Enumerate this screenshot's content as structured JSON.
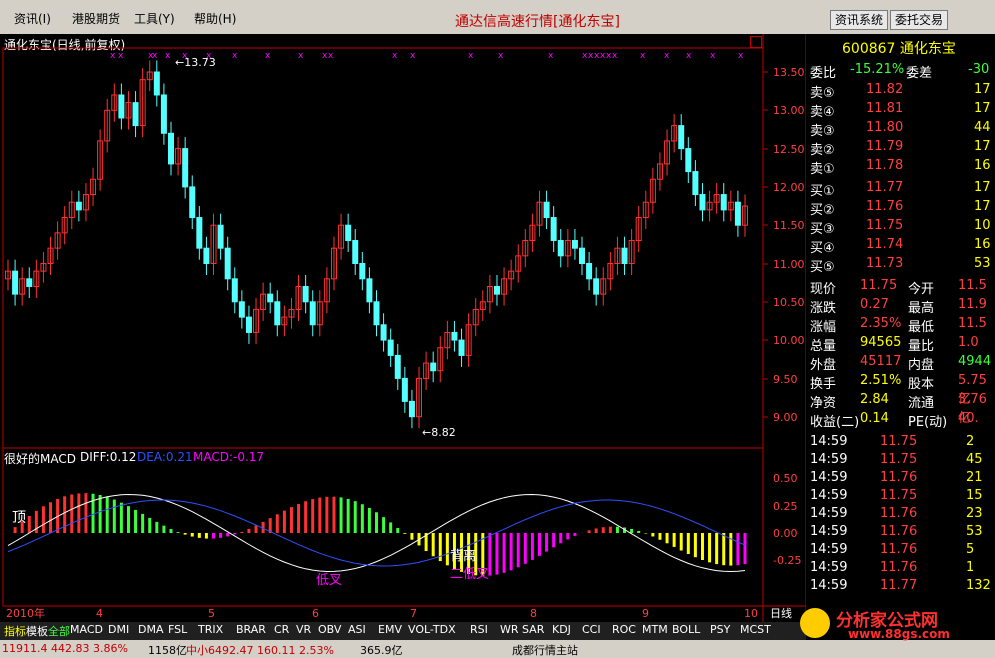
{
  "menu": {
    "items": [
      "资讯(I)",
      "港股期货",
      "工具(Y)",
      "帮助(H)"
    ]
  },
  "app_title": "通达信高速行情[通化东宝]",
  "buttons": {
    "news": "资讯系统",
    "trade": "委托交易"
  },
  "chart": {
    "title": "通化东宝(日线,前复权)",
    "price_ticks": [
      "13.50",
      "13.00",
      "12.50",
      "12.00",
      "11.50",
      "11.00",
      "10.50",
      "10.00",
      "9.50",
      "9.00"
    ],
    "high_label": "13.73",
    "low_label": "8.82",
    "macd_name": "很好的MACD",
    "diff": "DIFF:0.12",
    "dea": "DEA:0.21",
    "macd": "MACD:-0.17",
    "macd_ticks": [
      "0.50",
      "0.25",
      "0.00",
      "-0.25"
    ],
    "annotations": {
      "top": "顶",
      "low_cross": "低叉",
      "divergence": "背离",
      "second_low_cross": "二低叉"
    },
    "dates": [
      "2010年",
      "4",
      "5",
      "6",
      "7",
      "8",
      "9",
      "10"
    ],
    "period": "日线"
  },
  "quote": {
    "code": "600867",
    "name": "通化东宝",
    "weibi_label": "委比",
    "weibi": "-15.21%",
    "weicha_label": "委差",
    "weicha": "-30",
    "asks": [
      {
        "label": "卖⑤",
        "price": "11.82",
        "vol": "17"
      },
      {
        "label": "卖④",
        "price": "11.81",
        "vol": "17"
      },
      {
        "label": "卖③",
        "price": "11.80",
        "vol": "44"
      },
      {
        "label": "卖②",
        "price": "11.79",
        "vol": "17"
      },
      {
        "label": "卖①",
        "price": "11.78",
        "vol": "16"
      }
    ],
    "bids": [
      {
        "label": "买①",
        "price": "11.77",
        "vol": "17"
      },
      {
        "label": "买②",
        "price": "11.76",
        "vol": "17"
      },
      {
        "label": "买③",
        "price": "11.75",
        "vol": "10"
      },
      {
        "label": "买④",
        "price": "11.74",
        "vol": "16"
      },
      {
        "label": "买⑤",
        "price": "11.73",
        "vol": "53"
      }
    ],
    "stats": [
      {
        "l1": "现价",
        "v1": "11.75",
        "l2": "今开",
        "v2": "11.5"
      },
      {
        "l1": "涨跌",
        "v1": "0.27",
        "l2": "最高",
        "v2": "11.9"
      },
      {
        "l1": "涨幅",
        "v1": "2.35%",
        "l2": "最低",
        "v2": "11.5"
      },
      {
        "l1": "总量",
        "v1": "94565",
        "l2": "量比",
        "v2": "1.0"
      },
      {
        "l1": "外盘",
        "v1": "45117",
        "l2": "内盘",
        "v2": "4944"
      },
      {
        "l1": "换手",
        "v1": "2.51%",
        "l2": "股本",
        "v2": "5.75亿"
      },
      {
        "l1": "净资",
        "v1": "2.84",
        "l2": "流通",
        "v2": "3.76亿"
      },
      {
        "l1": "收益(二)",
        "v1": "0.14",
        "l2": "PE(动)",
        "v2": "40."
      }
    ],
    "ticks": [
      {
        "t": "14:59",
        "p": "11.75",
        "v": "2"
      },
      {
        "t": "14:59",
        "p": "11.75",
        "v": "45"
      },
      {
        "t": "14:59",
        "p": "11.76",
        "v": "21"
      },
      {
        "t": "14:59",
        "p": "11.75",
        "v": "15"
      },
      {
        "t": "14:59",
        "p": "11.76",
        "v": "23"
      },
      {
        "t": "14:59",
        "p": "11.76",
        "v": "53"
      },
      {
        "t": "14:59",
        "p": "11.76",
        "v": "5"
      },
      {
        "t": "14:59",
        "p": "11.76",
        "v": "1"
      },
      {
        "t": "14:59",
        "p": "11.77",
        "v": "132"
      }
    ]
  },
  "tabs": [
    "指标",
    "模板",
    "全部",
    "MACD",
    "DMI",
    "DMA",
    "FSL",
    "TRIX",
    "BRAR",
    "CR",
    "VR",
    "OBV",
    "ASI",
    "EMV",
    "VOL-TDX",
    "RSI",
    "WR",
    "SAR",
    "KDJ",
    "CCI",
    "ROC",
    "MTM",
    "BOLL",
    "PSY",
    "MCST"
  ],
  "status": {
    "index": "11911.4  442.83  3.86%",
    "amount": "1158亿",
    "mid": "中小6492.47  160.11  2.53%",
    "amount2": "365.9亿",
    "site": "成都行情主站"
  },
  "watermark": {
    "brand": "分析家公式网",
    "url": "www.88gs.com"
  },
  "colors": {
    "up": "#ff3232",
    "down": "#54ffff",
    "yellow": "#ffff00",
    "magenta": "#ff00ff"
  }
}
